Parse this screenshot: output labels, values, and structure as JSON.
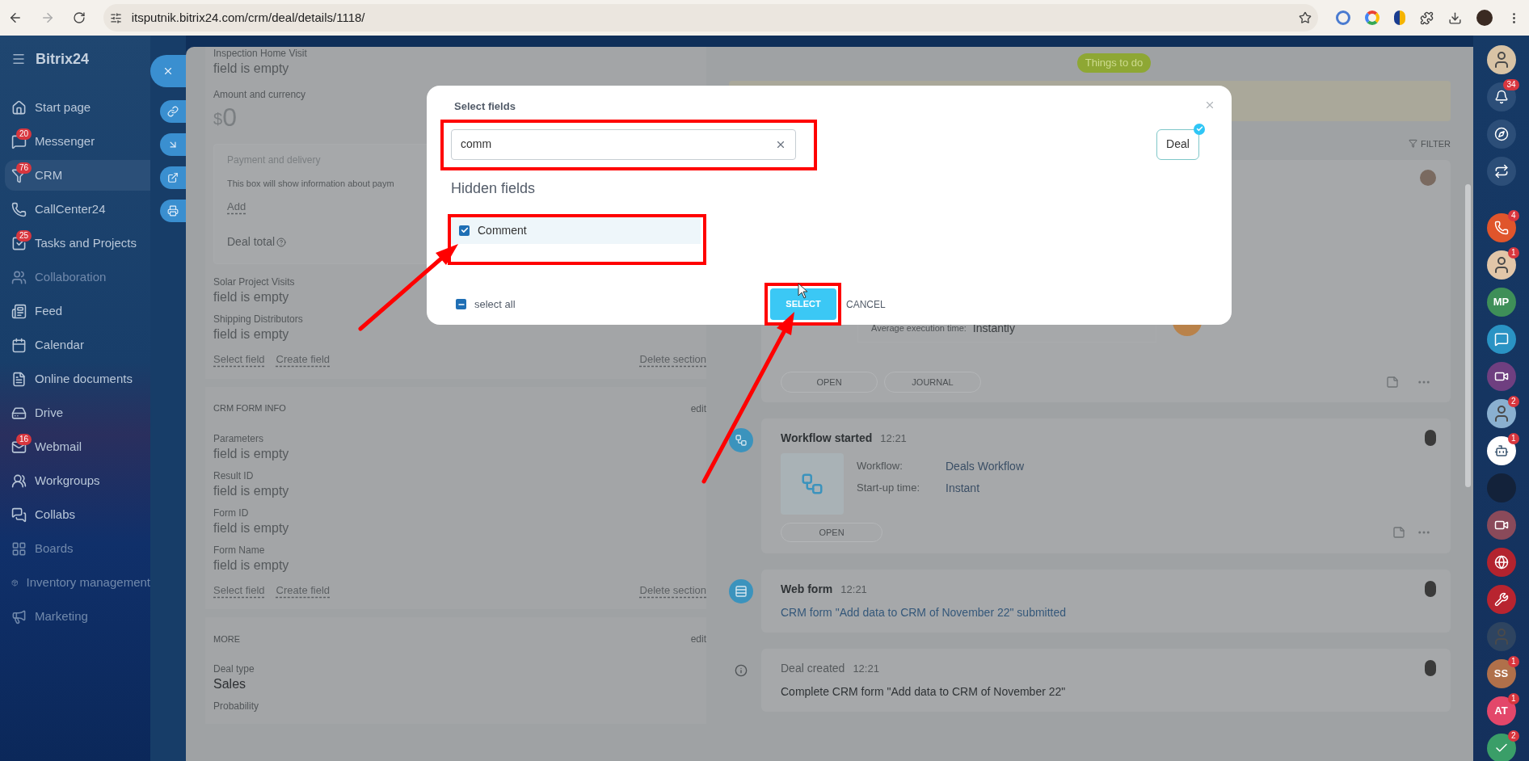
{
  "browser": {
    "url": "itsputnik.bitrix24.com/crm/deal/details/1118/"
  },
  "sidebar": {
    "logo": "Bitrix24",
    "items": [
      {
        "label": "Start page",
        "selected": false,
        "dimmed": false
      },
      {
        "label": "Messenger",
        "badge": "20",
        "selected": false,
        "dimmed": false
      },
      {
        "label": "CRM",
        "badge": "76",
        "selected": true,
        "dimmed": false
      },
      {
        "label": "CallCenter24",
        "selected": false,
        "dimmed": false
      },
      {
        "label": "Tasks and Projects",
        "badge": "25",
        "selected": false,
        "dimmed": false
      },
      {
        "label": "Collaboration",
        "selected": false,
        "dimmed": true
      },
      {
        "label": "Feed",
        "selected": false,
        "dimmed": false
      },
      {
        "label": "Calendar",
        "selected": false,
        "dimmed": false
      },
      {
        "label": "Online documents",
        "selected": false,
        "dimmed": false
      },
      {
        "label": "Drive",
        "selected": false,
        "dimmed": false
      },
      {
        "label": "Webmail",
        "badge": "16",
        "selected": false,
        "dimmed": false
      },
      {
        "label": "Workgroups",
        "selected": false,
        "dimmed": false
      },
      {
        "label": "Collabs",
        "selected": false,
        "dimmed": false
      },
      {
        "label": "Boards",
        "selected": false,
        "dimmed": true
      },
      {
        "label": "Inventory management",
        "selected": false,
        "dimmed": true
      },
      {
        "label": "Marketing",
        "selected": false,
        "dimmed": true
      }
    ]
  },
  "deal": {
    "main": {
      "top_fields": [
        {
          "label": "Inspection Home Visit",
          "value": "field is empty"
        }
      ],
      "amount": {
        "label": "Amount and currency",
        "currency": "$",
        "value": "0"
      },
      "payment_box": {
        "title": "Payment and delivery",
        "text": "This box will show information about paym",
        "add": "Add",
        "total": "Deal total"
      },
      "fields": [
        {
          "label": "Solar Project Visits",
          "value": "field is empty",
          "empty": true
        },
        {
          "label": "Shipping Distributors",
          "value": "field is empty",
          "empty": true
        }
      ],
      "links": [
        "Select field",
        "Create field"
      ],
      "delete": "Delete section"
    },
    "sections": [
      {
        "title": "CRM FORM INFO",
        "edit": "edit",
        "fields": [
          {
            "label": "Parameters",
            "value": "field is empty",
            "empty": true
          },
          {
            "label": "Result ID",
            "value": "field is empty",
            "empty": true
          },
          {
            "label": "Form ID",
            "value": "field is empty",
            "empty": true
          },
          {
            "label": "Form Name",
            "value": "field is empty",
            "empty": true
          }
        ],
        "links": [
          "Select field",
          "Create field"
        ],
        "delete": "Delete section"
      },
      {
        "title": "MORE",
        "edit": "edit",
        "fields": [
          {
            "label": "Deal type",
            "value": "Sales",
            "empty": false
          },
          {
            "label": "Probability"
          }
        ]
      }
    ]
  },
  "timeline": {
    "things_to_do": "Things to do",
    "filter": "FILTER",
    "activity": {
      "exec_label": "Average execution time:",
      "exec_value": "Instantly",
      "buttons": [
        "OPEN",
        "JOURNAL"
      ]
    },
    "entries": [
      {
        "kind": "workflow",
        "title": "Workflow started",
        "time": "12:21",
        "rows": [
          {
            "label": "Workflow:",
            "value": "Deals Workflow"
          },
          {
            "label": "Start-up time:",
            "value": "Instant"
          }
        ],
        "buttons": [
          "OPEN"
        ]
      },
      {
        "kind": "webform",
        "title": "Web form",
        "time": "12:21",
        "text": "CRM form \"Add data to CRM of November 22\" submitted"
      },
      {
        "kind": "created",
        "title": "Deal created",
        "time": "12:21",
        "text": "Complete CRM form \"Add data to CRM of November 22\""
      }
    ]
  },
  "dialog": {
    "title": "Select fields",
    "search": {
      "value": "comm"
    },
    "chip": {
      "label": "Deal",
      "selected": true
    },
    "heading": "Hidden fields",
    "fields": [
      {
        "label": "Comment",
        "checked": true
      }
    ],
    "select_all": {
      "label": "select all",
      "indeterminate": true
    },
    "select": "SELECT",
    "cancel": "CANCEL"
  },
  "rail": [
    {
      "kind": "avatar",
      "color": "#d8c3a5"
    },
    {
      "kind": "bell",
      "badge": "34",
      "color": "#2c4e78"
    },
    {
      "kind": "compass",
      "color": "#2c4e78"
    },
    {
      "kind": "swap",
      "color": "#2c4e78"
    },
    {
      "kind": "phone",
      "badge": "4",
      "color": "#e0552b"
    },
    {
      "kind": "avatar",
      "badge": "1",
      "color": "#e2c6a8"
    },
    {
      "kind": "initials",
      "text": "MP",
      "color": "#3e8f58"
    },
    {
      "kind": "chat",
      "color": "#2a93c4"
    },
    {
      "kind": "video",
      "color": "#6f3f80"
    },
    {
      "kind": "avatar",
      "badge": "2",
      "color": "#8ab0d0"
    },
    {
      "kind": "bot",
      "badge": "1",
      "color": "#ffffff"
    },
    {
      "kind": "plain",
      "color": "#13223a"
    },
    {
      "kind": "video",
      "color": "#8a4a5a"
    },
    {
      "kind": "globe",
      "color": "#b3232e"
    },
    {
      "kind": "tools",
      "color": "#b8242f"
    },
    {
      "kind": "avatar",
      "color": "#2e4460"
    },
    {
      "kind": "initials",
      "text": "SS",
      "badge": "1",
      "color": "#b0704a"
    },
    {
      "kind": "initials",
      "text": "AT",
      "badge": "1",
      "color": "#e3476a"
    },
    {
      "kind": "check",
      "badge": "2",
      "color": "#3a9e68"
    }
  ]
}
